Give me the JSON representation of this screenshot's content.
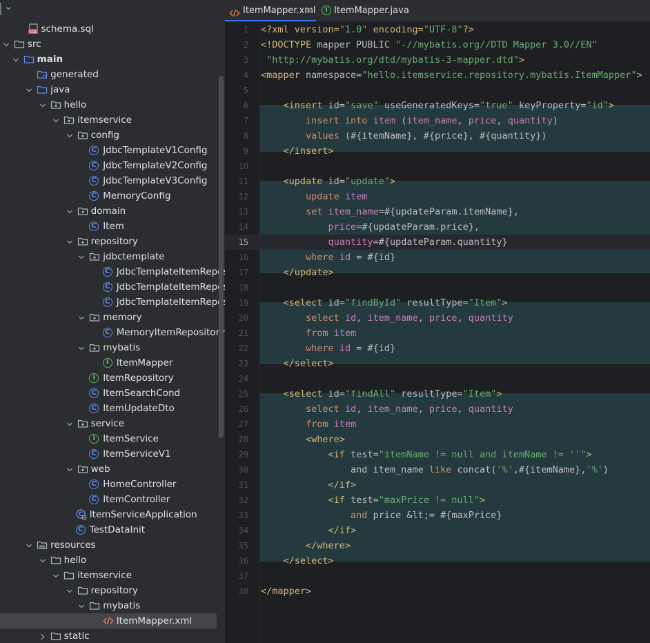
{
  "tree": {
    "rows": [
      {
        "label": "schema.sql",
        "kind": "sql",
        "depth": 1,
        "arrow": "none"
      },
      {
        "label": "src",
        "kind": "folder",
        "depth": 0,
        "arrow": "down"
      },
      {
        "label": "main",
        "kind": "folder-src",
        "depth": 0.7,
        "arrow": "down",
        "bold": true
      },
      {
        "label": "generated",
        "kind": "folder-gen",
        "depth": 1.7,
        "arrow": "none"
      },
      {
        "label": "java",
        "kind": "folder-src",
        "depth": 1.7,
        "arrow": "down"
      },
      {
        "label": "hello",
        "kind": "package",
        "depth": 2.7,
        "arrow": "down"
      },
      {
        "label": "itemservice",
        "kind": "package",
        "depth": 3.7,
        "arrow": "down"
      },
      {
        "label": "config",
        "kind": "package",
        "depth": 4.7,
        "arrow": "down"
      },
      {
        "label": "JdbcTemplateV1Config",
        "kind": "class",
        "depth": 5.6,
        "arrow": "none"
      },
      {
        "label": "JdbcTemplateV2Config",
        "kind": "class",
        "depth": 5.6,
        "arrow": "none"
      },
      {
        "label": "JdbcTemplateV3Config",
        "kind": "class",
        "depth": 5.6,
        "arrow": "none"
      },
      {
        "label": "MemoryConfig",
        "kind": "class",
        "depth": 5.6,
        "arrow": "none"
      },
      {
        "label": "domain",
        "kind": "package",
        "depth": 4.7,
        "arrow": "down"
      },
      {
        "label": "Item",
        "kind": "class",
        "depth": 5.6,
        "arrow": "none"
      },
      {
        "label": "repository",
        "kind": "package",
        "depth": 4.7,
        "arrow": "down"
      },
      {
        "label": "jdbctemplate",
        "kind": "package",
        "depth": 5.6,
        "arrow": "down"
      },
      {
        "label": "JdbcTemplateItemRepositor",
        "kind": "class",
        "depth": 6.6,
        "arrow": "none"
      },
      {
        "label": "JdbcTemplateItemRepositor",
        "kind": "class",
        "depth": 6.6,
        "arrow": "none"
      },
      {
        "label": "JdbcTemplateItemRepositor",
        "kind": "class",
        "depth": 6.6,
        "arrow": "none"
      },
      {
        "label": "memory",
        "kind": "package",
        "depth": 5.6,
        "arrow": "down"
      },
      {
        "label": "MemoryItemRepository",
        "kind": "class",
        "depth": 6.6,
        "arrow": "none"
      },
      {
        "label": "mybatis",
        "kind": "package",
        "depth": 5.6,
        "arrow": "down"
      },
      {
        "label": "ItemMapper",
        "kind": "interface",
        "depth": 6.6,
        "arrow": "none"
      },
      {
        "label": "ItemRepository",
        "kind": "interface",
        "depth": 5.6,
        "arrow": "none"
      },
      {
        "label": "ItemSearchCond",
        "kind": "class",
        "depth": 5.6,
        "arrow": "none"
      },
      {
        "label": "ItemUpdateDto",
        "kind": "class",
        "depth": 5.6,
        "arrow": "none"
      },
      {
        "label": "service",
        "kind": "package",
        "depth": 4.7,
        "arrow": "down"
      },
      {
        "label": "ItemService",
        "kind": "interface",
        "depth": 5.6,
        "arrow": "none"
      },
      {
        "label": "ItemServiceV1",
        "kind": "class",
        "depth": 5.6,
        "arrow": "none"
      },
      {
        "label": "web",
        "kind": "package",
        "depth": 4.7,
        "arrow": "down"
      },
      {
        "label": "HomeController",
        "kind": "class",
        "depth": 5.6,
        "arrow": "none"
      },
      {
        "label": "ItemController",
        "kind": "class",
        "depth": 5.6,
        "arrow": "none"
      },
      {
        "label": "ItemServiceApplication",
        "kind": "app",
        "depth": 4.6,
        "arrow": "none"
      },
      {
        "label": "TestDataInit",
        "kind": "class",
        "depth": 4.6,
        "arrow": "none"
      },
      {
        "label": "resources",
        "kind": "folder-res",
        "depth": 1.7,
        "arrow": "down"
      },
      {
        "label": "hello",
        "kind": "folder",
        "depth": 2.7,
        "arrow": "down"
      },
      {
        "label": "itemservice",
        "kind": "folder",
        "depth": 3.7,
        "arrow": "down"
      },
      {
        "label": "repository",
        "kind": "folder",
        "depth": 4.7,
        "arrow": "down"
      },
      {
        "label": "mybatis",
        "kind": "folder",
        "depth": 5.6,
        "arrow": "down"
      },
      {
        "label": "ItemMapper.xml",
        "kind": "xml",
        "depth": 6.6,
        "arrow": "none",
        "selected": true
      },
      {
        "label": "static",
        "kind": "folder",
        "depth": 2.7,
        "arrow": "right"
      }
    ]
  },
  "tabs": [
    {
      "label": "ItemMapper.xml",
      "icon": "xml-icon",
      "active": true
    },
    {
      "label": "ItemMapper.java",
      "icon": "interface-icon",
      "active": false
    }
  ],
  "editor": {
    "current_line": 15,
    "lines": [
      [
        [
          "t-pi",
          "<?xml version="
        ],
        [
          "t-str",
          "\"1.0\""
        ],
        [
          "t-pi",
          " encoding="
        ],
        [
          "t-str",
          "\"UTF-8\""
        ],
        [
          "t-pi",
          "?>"
        ]
      ],
      [
        [
          "t-tag",
          "<!DOCTYPE "
        ],
        [
          "t-plain",
          "mapper PUBLIC "
        ],
        [
          "t-str",
          "\"-//mybatis.org//DTD Mapper 3.0//EN\""
        ]
      ],
      [
        [
          "t-str",
          " \"http://mybatis.org/dtd/mybatis-3-mapper.dtd\""
        ],
        [
          "t-tag",
          ">"
        ]
      ],
      [
        [
          "t-tag",
          "<mapper "
        ],
        [
          "t-attr",
          "namespace="
        ],
        [
          "t-str",
          "\"hello.itemservice.repository.mybatis.ItemMapper\""
        ],
        [
          "t-tag",
          ">"
        ]
      ],
      [],
      [
        [
          "t-plain",
          "    "
        ],
        [
          "t-tag",
          "<insert "
        ],
        [
          "t-attr",
          "id="
        ],
        [
          "t-str",
          "\"save\""
        ],
        [
          "t-attr",
          " useGeneratedKeys="
        ],
        [
          "t-str",
          "\"true\""
        ],
        [
          "t-attr",
          " keyProperty="
        ],
        [
          "t-str",
          "\"id\""
        ],
        [
          "t-tag",
          ">"
        ]
      ],
      [
        [
          "t-plain",
          "        "
        ],
        [
          "t-kw",
          "insert into "
        ],
        [
          "t-id",
          "item"
        ],
        [
          "t-plain",
          " ("
        ],
        [
          "t-id",
          "item_name"
        ],
        [
          "t-plain",
          ", "
        ],
        [
          "t-id",
          "price"
        ],
        [
          "t-plain",
          ", "
        ],
        [
          "t-id",
          "quantity"
        ],
        [
          "t-plain",
          ")"
        ]
      ],
      [
        [
          "t-plain",
          "        "
        ],
        [
          "t-kw",
          "values "
        ],
        [
          "t-plain",
          "(#{itemName}, #{price}, #{quantity})"
        ]
      ],
      [
        [
          "t-plain",
          "    "
        ],
        [
          "t-tag",
          "</insert>"
        ]
      ],
      [],
      [
        [
          "t-plain",
          "    "
        ],
        [
          "t-tag",
          "<update "
        ],
        [
          "t-attr",
          "id="
        ],
        [
          "t-str",
          "\"update\""
        ],
        [
          "t-tag",
          ">"
        ]
      ],
      [
        [
          "t-plain",
          "        "
        ],
        [
          "t-kw",
          "update "
        ],
        [
          "t-id",
          "item"
        ]
      ],
      [
        [
          "t-plain",
          "        "
        ],
        [
          "t-kw",
          "set "
        ],
        [
          "t-id",
          "item_name"
        ],
        [
          "t-plain",
          "=#{updateParam.itemName},"
        ]
      ],
      [
        [
          "t-plain",
          "            "
        ],
        [
          "t-id",
          "price"
        ],
        [
          "t-plain",
          "=#{updateParam.price},"
        ]
      ],
      [
        [
          "t-plain",
          "            "
        ],
        [
          "t-id",
          "quantity"
        ],
        [
          "t-plain",
          "=#{updateParam.quantity}"
        ]
      ],
      [
        [
          "t-plain",
          "        "
        ],
        [
          "t-kw",
          "where "
        ],
        [
          "t-id",
          "id"
        ],
        [
          "t-plain",
          " = #{id}"
        ]
      ],
      [
        [
          "t-plain",
          "    "
        ],
        [
          "t-tag",
          "</update>"
        ]
      ],
      [],
      [
        [
          "t-plain",
          "    "
        ],
        [
          "t-tag",
          "<select "
        ],
        [
          "t-attr",
          "id="
        ],
        [
          "t-str",
          "\"findById\""
        ],
        [
          "t-attr",
          " resultType="
        ],
        [
          "t-str",
          "\"Item\""
        ],
        [
          "t-tag",
          ">"
        ]
      ],
      [
        [
          "t-plain",
          "        "
        ],
        [
          "t-kw",
          "select "
        ],
        [
          "t-id",
          "id"
        ],
        [
          "t-plain",
          ", "
        ],
        [
          "t-id",
          "item_name"
        ],
        [
          "t-plain",
          ", "
        ],
        [
          "t-id",
          "price"
        ],
        [
          "t-plain",
          ", "
        ],
        [
          "t-id",
          "quantity"
        ]
      ],
      [
        [
          "t-plain",
          "        "
        ],
        [
          "t-kw",
          "from "
        ],
        [
          "t-id",
          "item"
        ]
      ],
      [
        [
          "t-plain",
          "        "
        ],
        [
          "t-kw",
          "where "
        ],
        [
          "t-id",
          "id"
        ],
        [
          "t-plain",
          " = #{id}"
        ]
      ],
      [
        [
          "t-plain",
          "    "
        ],
        [
          "t-tag",
          "</select>"
        ]
      ],
      [],
      [
        [
          "t-plain",
          "    "
        ],
        [
          "t-tag",
          "<select "
        ],
        [
          "t-attr",
          "id="
        ],
        [
          "t-str",
          "\"findAll\""
        ],
        [
          "t-attr",
          " resultType="
        ],
        [
          "t-str",
          "\"Item\""
        ],
        [
          "t-tag",
          ">"
        ]
      ],
      [
        [
          "t-plain",
          "        "
        ],
        [
          "t-kw",
          "select "
        ],
        [
          "t-id",
          "id"
        ],
        [
          "t-plain",
          ", "
        ],
        [
          "t-id",
          "item_name"
        ],
        [
          "t-plain",
          ", "
        ],
        [
          "t-id",
          "price"
        ],
        [
          "t-plain",
          ", "
        ],
        [
          "t-id",
          "quantity"
        ]
      ],
      [
        [
          "t-plain",
          "        "
        ],
        [
          "t-kw",
          "from "
        ],
        [
          "t-id",
          "item"
        ]
      ],
      [
        [
          "t-plain",
          "        "
        ],
        [
          "t-tag",
          "<where>"
        ]
      ],
      [
        [
          "t-plain",
          "            "
        ],
        [
          "t-tag",
          "<if "
        ],
        [
          "t-attr",
          "test="
        ],
        [
          "t-str",
          "\"itemName != null and itemName != ''\""
        ],
        [
          "t-tag",
          ">"
        ]
      ],
      [
        [
          "t-plain",
          "                and item_name "
        ],
        [
          "t-kw",
          "like "
        ],
        [
          "t-plain",
          "concat("
        ],
        [
          "t-str",
          "'%'"
        ],
        [
          "t-plain",
          ",#{itemName},"
        ],
        [
          "t-str",
          "'%'"
        ],
        [
          "t-plain",
          ")"
        ]
      ],
      [
        [
          "t-plain",
          "            "
        ],
        [
          "t-tag",
          "</if>"
        ]
      ],
      [
        [
          "t-plain",
          "            "
        ],
        [
          "t-tag",
          "<if "
        ],
        [
          "t-attr",
          "test="
        ],
        [
          "t-str",
          "\"maxPrice != null\""
        ],
        [
          "t-tag",
          ">"
        ]
      ],
      [
        [
          "t-plain",
          "                "
        ],
        [
          "t-kw",
          "and "
        ],
        [
          "t-plain",
          "price &lt;= #{maxPrice}"
        ]
      ],
      [
        [
          "t-plain",
          "            "
        ],
        [
          "t-tag",
          "</if>"
        ]
      ],
      [
        [
          "t-plain",
          "        "
        ],
        [
          "t-tag",
          "</where>"
        ]
      ],
      [
        [
          "t-plain",
          "    "
        ],
        [
          "t-tag",
          "</select>"
        ]
      ],
      [],
      [
        [
          "t-tag",
          "</mapper>"
        ]
      ]
    ]
  },
  "colors": {
    "accent": "#3574f0",
    "class_icon": "#5b8def",
    "interface_icon": "#5fb865",
    "tag": "#d5b778",
    "string": "#6aab73",
    "keyword": "#cf8e6d",
    "identifier": "#c77dbb",
    "block_highlight": "#243a3e"
  }
}
